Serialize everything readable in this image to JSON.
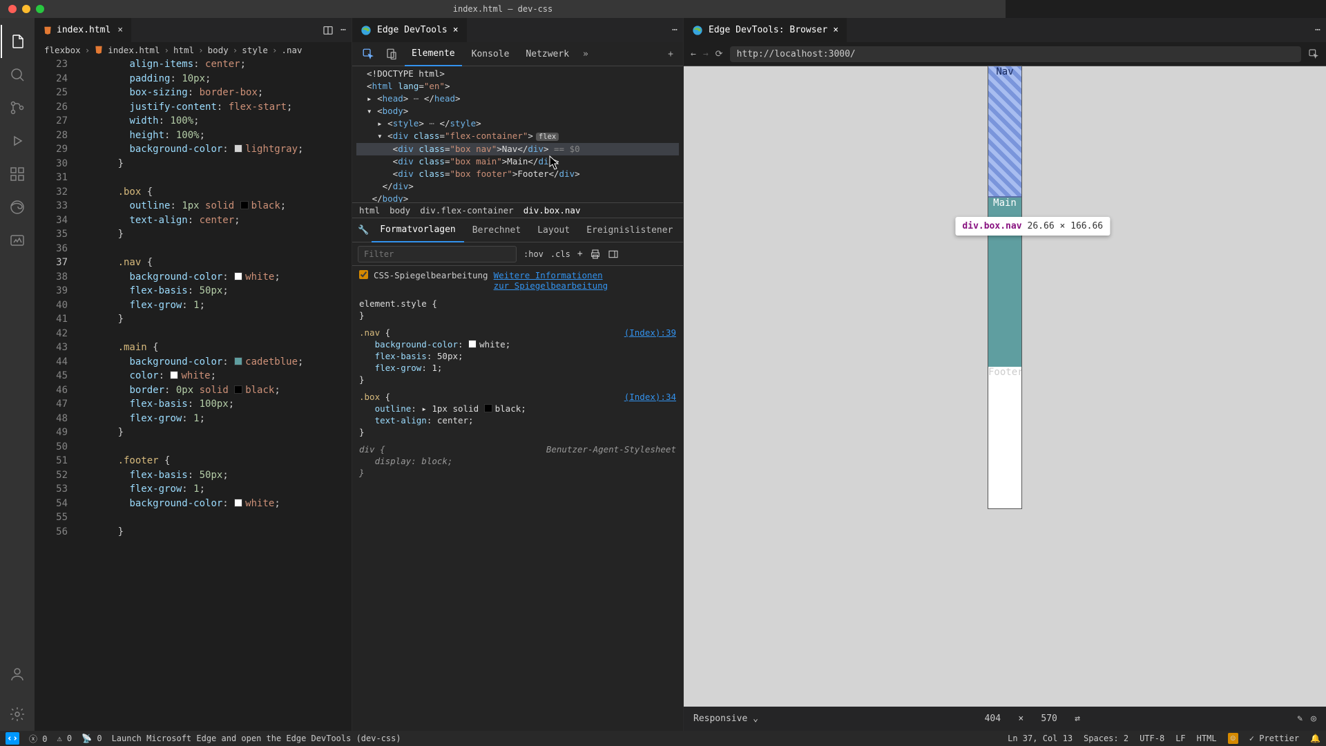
{
  "window": {
    "title": "index.html — dev-css"
  },
  "editor": {
    "tab": {
      "label": "index.html"
    },
    "breadcrumbs": [
      "flexbox",
      "index.html",
      "html",
      "body",
      "style",
      ".nav"
    ],
    "startLine": 23,
    "activeLine": 37
  },
  "devtools": {
    "tab": {
      "label": "Edge DevTools"
    },
    "tabs": [
      "Elemente",
      "Konsole",
      "Netzwerk"
    ],
    "crumbs": [
      "html",
      "body",
      "div.flex-container",
      "div.box.nav"
    ],
    "stylesTabs": [
      "Formatvorlagen",
      "Berechnet",
      "Layout",
      "Ereignislistener"
    ],
    "filter": {
      "placeholder": "Filter",
      "hov": ":hov",
      "cls": ".cls"
    },
    "mirror": {
      "label": "CSS-Spiegelbearbeitung",
      "link": "Weitere Informationen zur Spiegelbearbeitung"
    },
    "rules": {
      "elementStyle": "element.style {",
      "navSrc": "(Index):39",
      "boxSrc": "(Index):34",
      "uas": "Benutzer-Agent-Stylesheet"
    }
  },
  "browser": {
    "tab": {
      "label": "Edge DevTools: Browser"
    },
    "url": "http://localhost:3000/",
    "tooltip": {
      "selector": "div.box.nav",
      "dims": "26.66 × 166.66"
    },
    "phone": {
      "nav": "Nav",
      "main": "Main",
      "footer": "Footer"
    },
    "device": {
      "label": "Responsive",
      "w": "404",
      "x": "×",
      "h": "570"
    }
  },
  "status": {
    "errors": "0",
    "warnings": "0",
    "port": "0",
    "launch": "Launch Microsoft Edge and open the Edge DevTools (dev-css)",
    "pos": "Ln 37, Col 13",
    "spaces": "Spaces: 2",
    "enc": "UTF-8",
    "eol": "LF",
    "lang": "HTML",
    "prettier": "Prettier"
  }
}
